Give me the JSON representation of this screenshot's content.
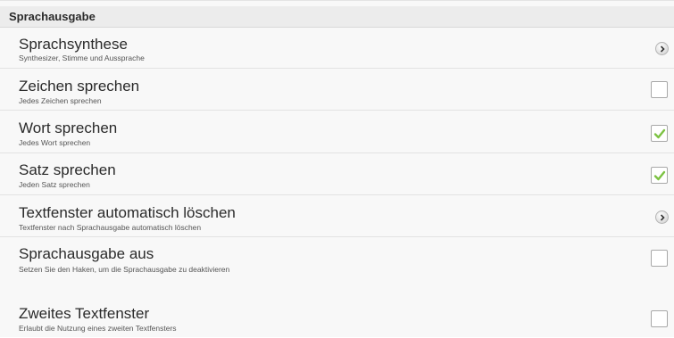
{
  "section": {
    "title": "Sprachausgabe"
  },
  "items": [
    {
      "title": "Sprachsynthese",
      "subtitle": "Synthesizer, Stimme und Aussprache",
      "control": "chevron",
      "icon": "chevron-right-icon"
    },
    {
      "title": "Zeichen sprechen",
      "subtitle": "Jedes Zeichen sprechen",
      "control": "checkbox",
      "checked": false
    },
    {
      "title": "Wort sprechen",
      "subtitle": "Jedes Wort sprechen",
      "control": "checkbox",
      "checked": true
    },
    {
      "title": "Satz sprechen",
      "subtitle": "Jeden Satz sprechen",
      "control": "checkbox",
      "checked": true
    },
    {
      "title": "Textfenster automatisch löschen",
      "subtitle": "Textfenster nach Sprachausgabe automatisch löschen",
      "control": "chevron",
      "icon": "chevron-right-icon"
    },
    {
      "title": "Sprachausgabe aus",
      "subtitle": "Setzen Sie den Haken, um die Sprachausgabe zu deaktivieren",
      "control": "checkbox",
      "checked": false
    },
    {
      "title": "Zweites Textfenster",
      "subtitle": "Erlaubt die Nutzung eines zweiten Textfensters",
      "control": "checkbox",
      "checked": false
    }
  ],
  "colors": {
    "check": "#7cc242",
    "section_bg": "#ececec",
    "row_bg": "#f8f8f8"
  }
}
